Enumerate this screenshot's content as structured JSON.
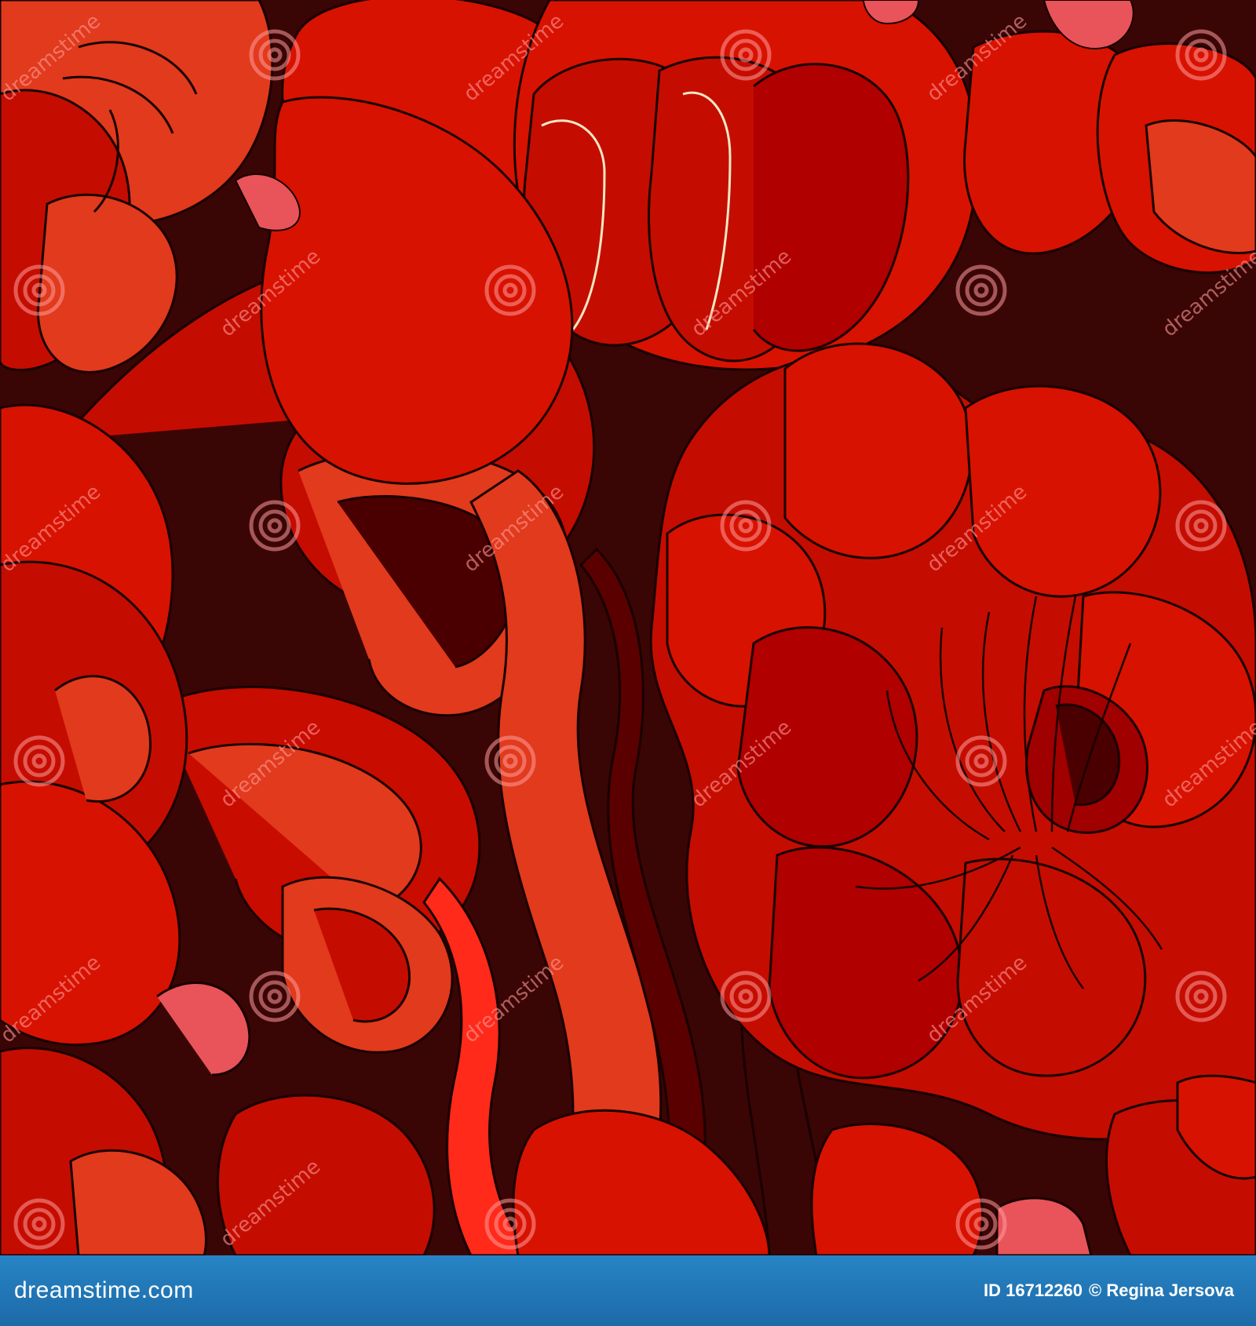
{
  "image": {
    "subject": "red poppy and peony flower seamless pattern",
    "palette": {
      "background": "#3a0505",
      "deep_red": "#b00000",
      "red": "#d81200",
      "orange_red": "#e13a1c",
      "pink": "#e8545a",
      "dark_maroon": "#4a0000",
      "outline": "#1a0000",
      "cream": "#f6e7c4"
    }
  },
  "watermark": {
    "word": "dreamstime",
    "icon": "spiral-icon"
  },
  "footer": {
    "site": "dreamstime.com",
    "id_label": "ID 16712260",
    "credit": "© Regina Jersova",
    "background": "#2279bd"
  }
}
